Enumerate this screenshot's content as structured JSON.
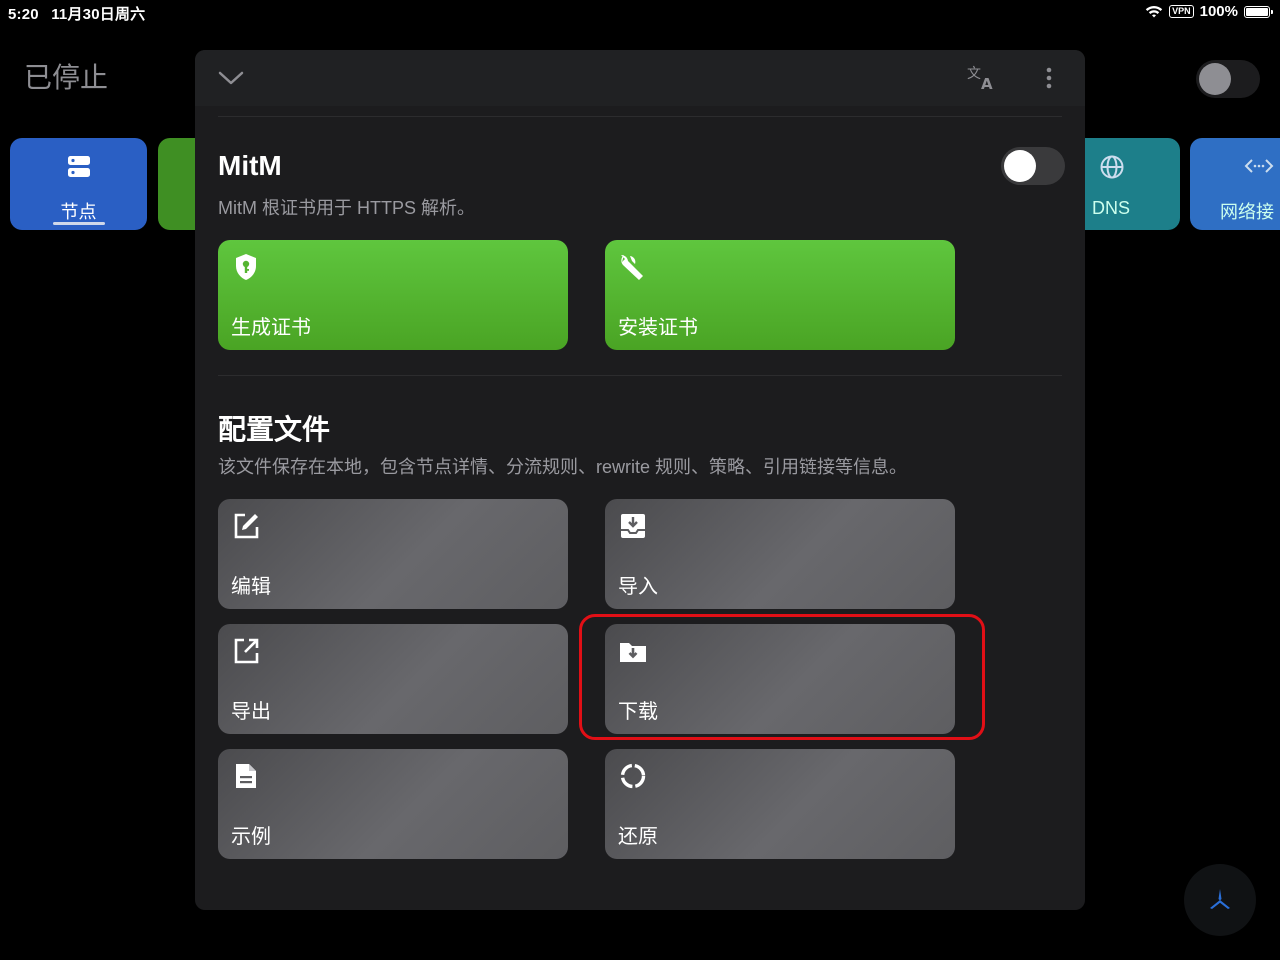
{
  "status_bar": {
    "time": "5:20",
    "date": "11月30日周六",
    "vpn": "VPN",
    "battery": "100%"
  },
  "background": {
    "title": "已停止",
    "tiles": [
      {
        "label": "节点",
        "icon": "server-icon",
        "color": "#2a5fc4"
      },
      {
        "label": "",
        "icon": "",
        "color": "#3f8f23"
      },
      {
        "label": "DNS",
        "icon": "globe-icon",
        "color": "#1d7f8a"
      },
      {
        "label": "网络接",
        "icon": "code-arrows-icon",
        "color": "#2f6fc4"
      }
    ]
  },
  "sheet": {
    "mitm": {
      "title": "MitM",
      "description": "MitM 根证书用于 HTTPS 解析。",
      "actions": [
        {
          "label": "生成证书",
          "icon": "shield-key-icon"
        },
        {
          "label": "安装证书",
          "icon": "wrench-icon"
        }
      ]
    },
    "profile": {
      "title": "配置文件",
      "description": "该文件保存在本地，包含节点详情、分流规则、rewrite 规则、策略、引用链接等信息。",
      "actions": [
        {
          "label": "编辑",
          "icon": "edit-icon"
        },
        {
          "label": "导入",
          "icon": "import-icon"
        },
        {
          "label": "导出",
          "icon": "export-icon"
        },
        {
          "label": "下载",
          "icon": "folder-download-icon"
        },
        {
          "label": "示例",
          "icon": "document-icon"
        },
        {
          "label": "还原",
          "icon": "restore-icon"
        }
      ]
    }
  },
  "colors": {
    "accent_green": "#55b531",
    "highlight_red": "#e10f16",
    "sheet_bg": "#1c1c1e"
  }
}
